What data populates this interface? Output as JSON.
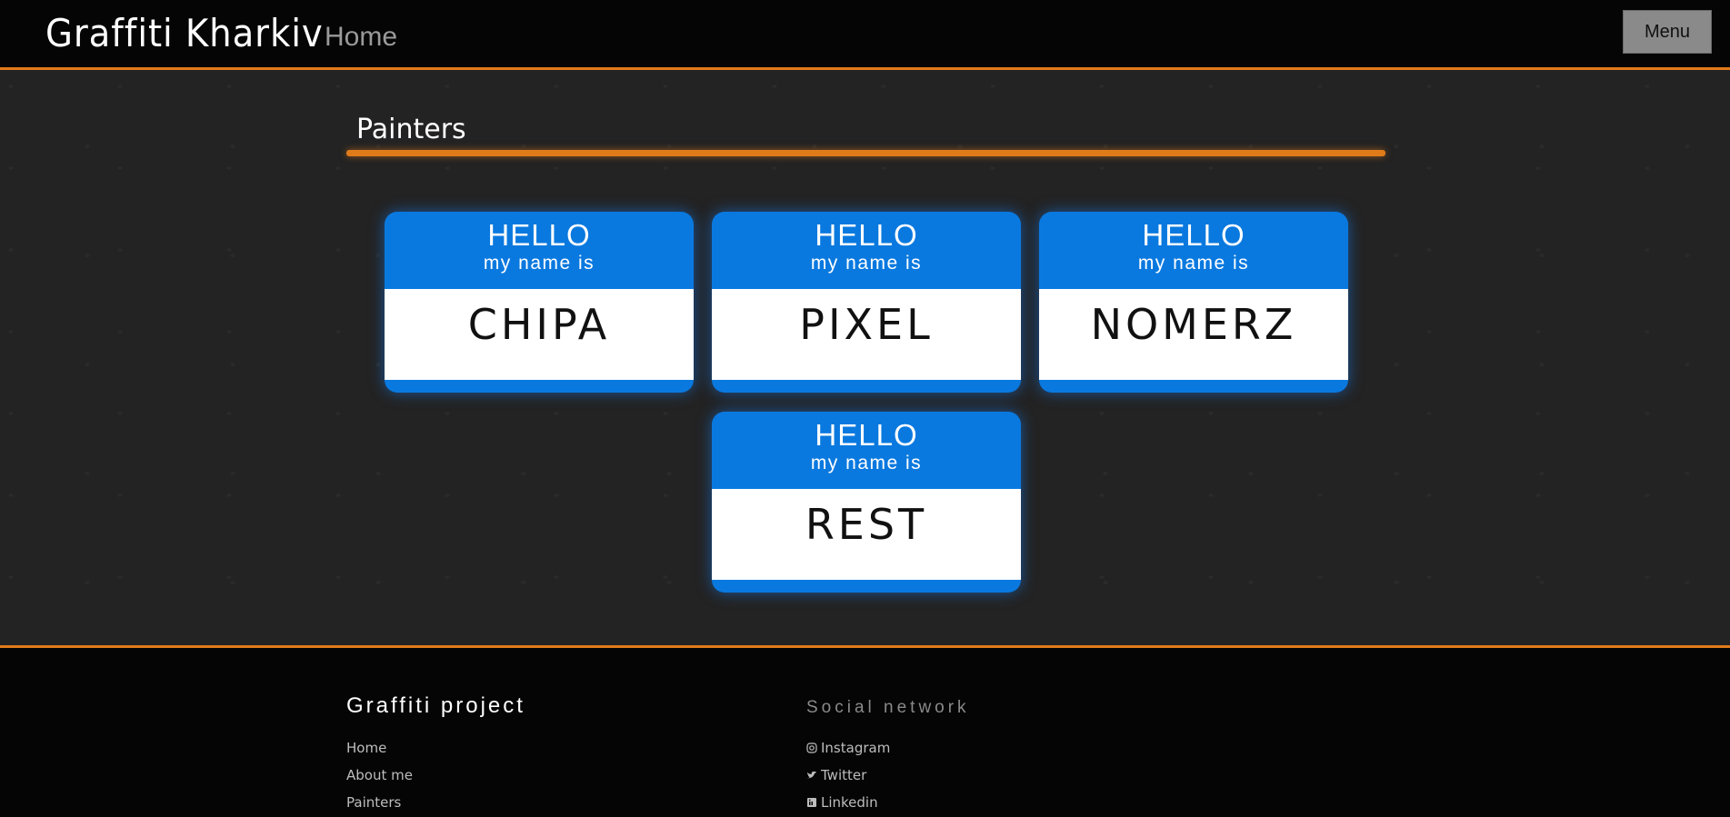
{
  "header": {
    "brand": "Graffiti Kharkiv",
    "page": "Home",
    "menu_label": "Menu"
  },
  "main": {
    "section_title": "Painters",
    "cards": [
      {
        "hello": "HELLO",
        "subtitle": "my name is",
        "name": "CHIPA"
      },
      {
        "hello": "HELLO",
        "subtitle": "my name is",
        "name": "PIXEL"
      },
      {
        "hello": "HELLO",
        "subtitle": "my name is",
        "name": "NOMERZ"
      },
      {
        "hello": "HELLO",
        "subtitle": "my name is",
        "name": "REST"
      }
    ]
  },
  "footer": {
    "project_title": "Graffiti project",
    "links": [
      "Home",
      "About me",
      "Painters"
    ],
    "social_title": "Social network",
    "social": [
      {
        "label": "Instagram",
        "icon": "instagram-icon"
      },
      {
        "label": "Twitter",
        "icon": "twitter-icon"
      },
      {
        "label": "Linkedin",
        "icon": "linkedin-icon"
      }
    ]
  },
  "colors": {
    "accent": "#e07b1a",
    "card_blue": "#0a79df",
    "background": "#232323"
  }
}
